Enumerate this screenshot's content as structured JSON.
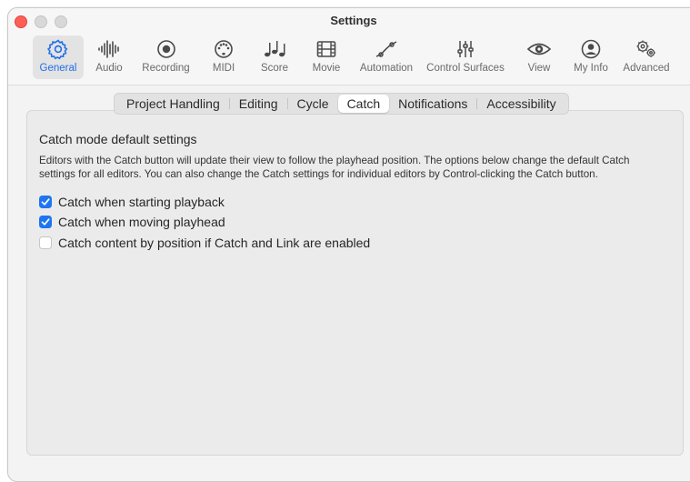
{
  "window": {
    "title": "Settings"
  },
  "toolbar": {
    "items": [
      {
        "label": "General",
        "icon": "gear-icon",
        "active": true
      },
      {
        "label": "Audio",
        "icon": "waveform-icon"
      },
      {
        "label": "Recording",
        "icon": "record-icon"
      },
      {
        "label": "MIDI",
        "icon": "midi-port-icon"
      },
      {
        "label": "Score",
        "icon": "music-notes-icon"
      },
      {
        "label": "Movie",
        "icon": "film-icon"
      },
      {
        "label": "Automation",
        "icon": "automation-curve-icon"
      },
      {
        "label": "Control Surfaces",
        "icon": "sliders-icon"
      },
      {
        "label": "View",
        "icon": "eye-icon"
      },
      {
        "label": "My Info",
        "icon": "person-icon"
      },
      {
        "label": "Advanced",
        "icon": "gears-icon"
      }
    ]
  },
  "tabs": [
    {
      "label": "Project Handling"
    },
    {
      "label": "Editing"
    },
    {
      "label": "Cycle"
    },
    {
      "label": "Catch",
      "selected": true
    },
    {
      "label": "Notifications"
    },
    {
      "label": "Accessibility"
    }
  ],
  "catch": {
    "section_title": "Catch mode default settings",
    "description": "Editors with the Catch button will update their view to follow the playhead position. The options below change the default Catch settings for all editors. You can also change the Catch settings for individual editors by Control-clicking the Catch button.",
    "options": [
      {
        "label": "Catch when starting playback",
        "checked": true
      },
      {
        "label": "Catch when moving playhead",
        "checked": true
      },
      {
        "label": "Catch content by position if Catch and Link are enabled",
        "checked": false
      }
    ]
  },
  "colors": {
    "accent": "#1f75f0",
    "close": "#fe5f57"
  }
}
